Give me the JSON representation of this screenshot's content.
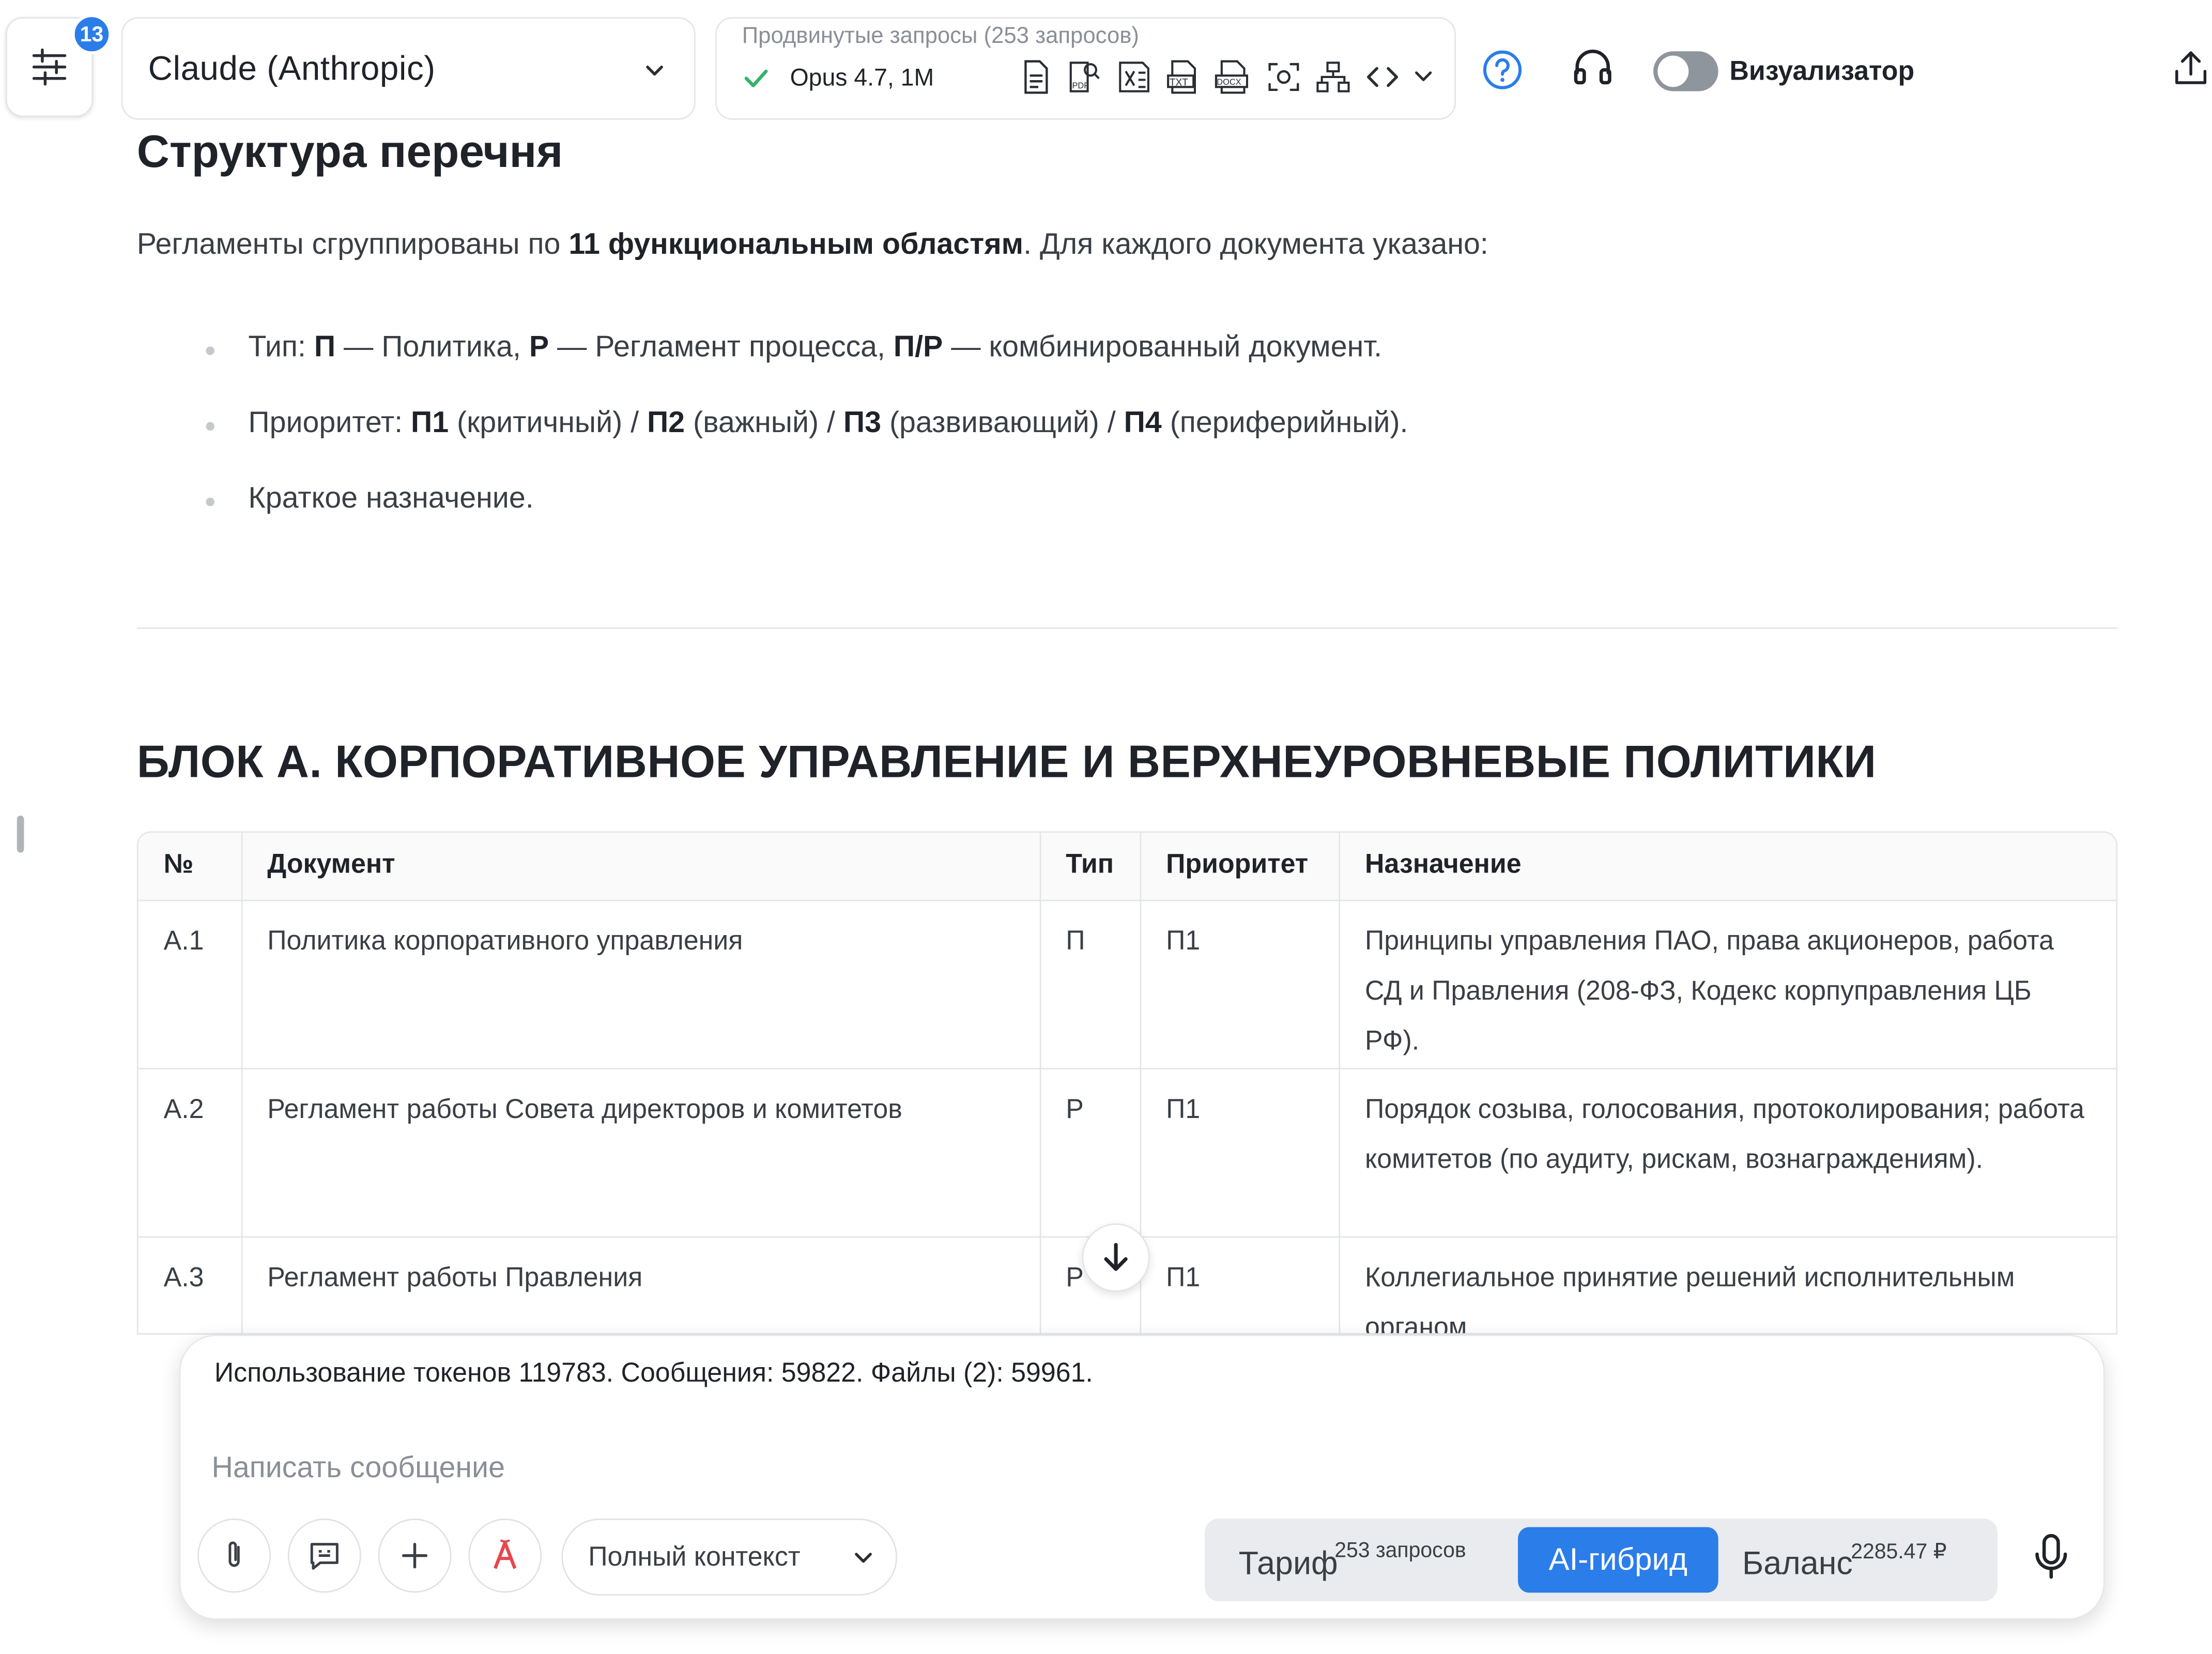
{
  "header": {
    "settings_badge": "13",
    "model_select": "Claude (Anthropic)",
    "advanced": {
      "title": "Продвинутые запросы (253 запросов)",
      "model": "Opus 4.7, 1M",
      "file_type_icons": [
        "document-icon",
        "pdf-search-icon",
        "excel-icon",
        "txt-icon",
        "docx-icon",
        "screenshot-icon",
        "sitemap-icon",
        "code-icon",
        "chevron-down-icon"
      ]
    },
    "visualizer_label": "Визуализатор",
    "visualizer_on": false
  },
  "content": {
    "heading": "Структура перечня",
    "intro": {
      "pre": "Регламенты сгруппированы по ",
      "bold": "11 функциональным областям",
      "post": ". Для каждого документа указано:"
    },
    "bullets": {
      "type": {
        "t1": "Тип: ",
        "b1": "П",
        "t2": " — Политика, ",
        "b2": "Р",
        "t3": " — Регламент процесса, ",
        "b3": "П/Р",
        "t4": " — комбинированный документ."
      },
      "priority": {
        "t1": "Приоритет: ",
        "b1": "П1",
        "t2": " (критичный) / ",
        "b2": "П2",
        "t3": " (важный) / ",
        "b3": "П3",
        "t4": " (развивающий) / ",
        "b4": "П4",
        "t5": " (периферийный)."
      },
      "purpose": "Краткое назначение."
    },
    "block_heading": "БЛОК А. КОРПОРАТИВНОЕ УПРАВЛЕНИЕ И ВЕРХНЕУРОВНЕВЫЕ ПОЛИТИКИ",
    "table": {
      "headers": [
        "№",
        "Документ",
        "Тип",
        "Приоритет",
        "Назначение"
      ],
      "rows": [
        [
          "А.1",
          "Политика корпоративного управления",
          "П",
          "П1",
          "Принципы управления ПАО, права акционеров, работа СД и Правления (208-ФЗ, Кодекс корпуправления ЦБ РФ)."
        ],
        [
          "А.2",
          "Регламент работы Совета директоров и комитетов",
          "Р",
          "П1",
          "Порядок созыва, голосования, протоколирования; работа комитетов (по аудиту, рискам, вознаграждениям)."
        ],
        [
          "А.3",
          "Регламент работы Правления",
          "Р",
          "П1",
          "Коллегиальное принятие решений исполнительным органом."
        ]
      ]
    }
  },
  "composer": {
    "token_usage": "Использование токенов 119783. Сообщения: 59822. Файлы (2): 59961.",
    "placeholder": "Написать сообщение",
    "context_mode": "Полный контекст",
    "tariff_label": "Тариф",
    "tariff_value": "253 запросов",
    "hybrid_label": "AI-гибрид",
    "balance_label": "Баланс",
    "balance_value": "2285.47 ₽"
  },
  "colors": {
    "accent": "#2b7de9",
    "success": "#34b26a",
    "text": "#1f2329",
    "muted": "#8a8f97",
    "border": "#e3e5e8"
  }
}
